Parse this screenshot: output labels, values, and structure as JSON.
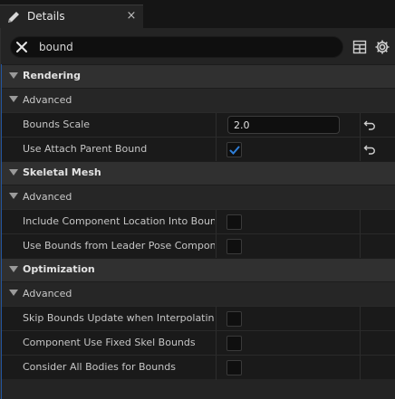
{
  "tab": {
    "title": "Details",
    "icon": "pencil-icon",
    "close": "×"
  },
  "search": {
    "value": "bound",
    "placeholder": ""
  },
  "toolbar": {
    "grid_icon": "table-view-icon",
    "settings_icon": "gear-icon"
  },
  "colors": {
    "accent": "#2356a0",
    "check": "#2f7fd9"
  },
  "sections": [
    {
      "label": "Rendering",
      "sub": "Advanced",
      "props": [
        {
          "label": "Bounds Scale",
          "type": "number",
          "value": "2.0",
          "reset": true
        },
        {
          "label": "Use Attach Parent Bound",
          "type": "checkbox",
          "checked": true,
          "reset": true
        }
      ]
    },
    {
      "label": "Skeletal Mesh",
      "sub": "Advanced",
      "props": [
        {
          "label": "Include Component Location Into Bounds",
          "type": "checkbox",
          "checked": false
        },
        {
          "label": "Use Bounds from Leader Pose Component",
          "type": "checkbox",
          "checked": false
        }
      ]
    },
    {
      "label": "Optimization",
      "sub": "Advanced",
      "props": [
        {
          "label": "Skip Bounds Update when Interpolating",
          "type": "checkbox",
          "checked": false
        },
        {
          "label": "Component Use Fixed Skel Bounds",
          "type": "checkbox",
          "checked": false
        },
        {
          "label": "Consider All Bodies for Bounds",
          "type": "checkbox",
          "checked": false
        }
      ]
    }
  ]
}
